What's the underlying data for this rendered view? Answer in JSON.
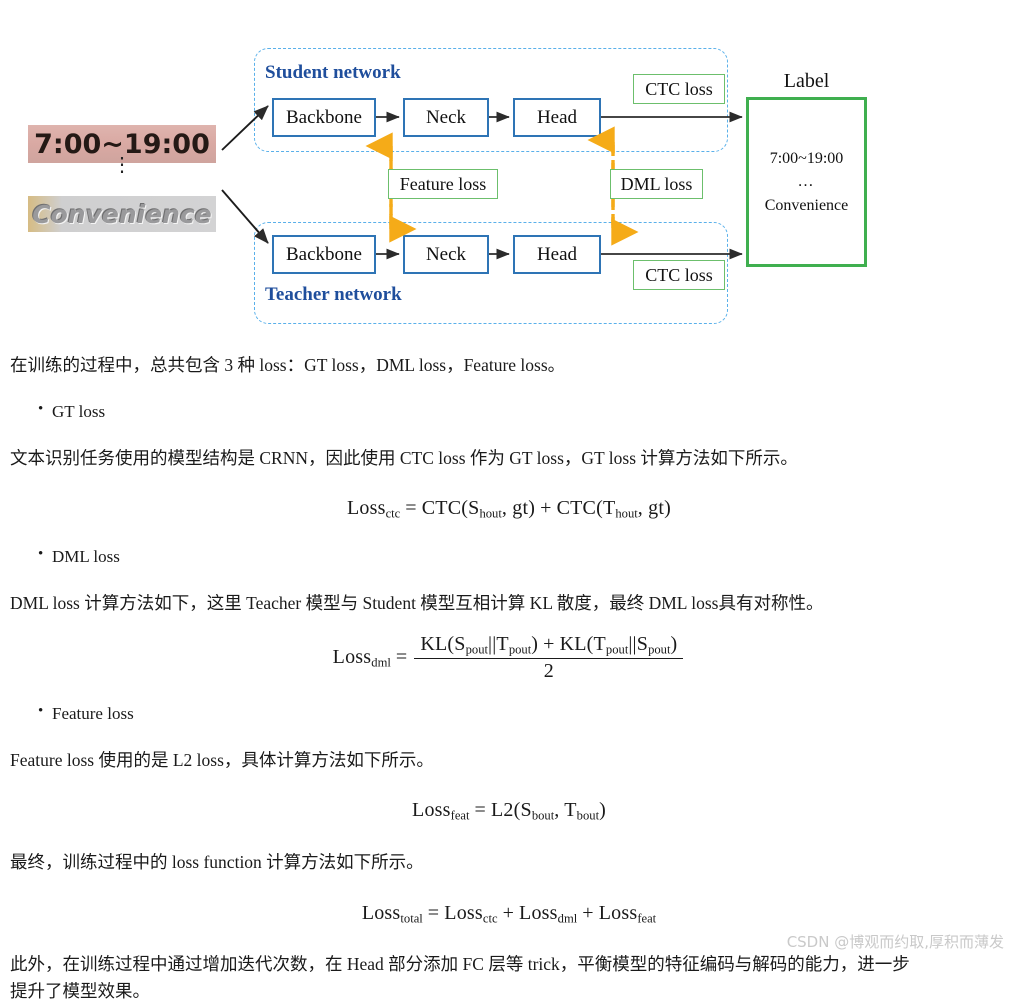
{
  "diagram": {
    "samples": {
      "time_image_text": "7:00~19:00",
      "ellipsis": "⋮",
      "convenience_image_text": "Convenience"
    },
    "student_network_label": "Student network",
    "teacher_network_label": "Teacher network",
    "student_modules": [
      "Backbone",
      "Neck",
      "Head"
    ],
    "teacher_modules": [
      "Backbone",
      "Neck",
      "Head"
    ],
    "loss_boxes": {
      "ctc_top": "CTC loss",
      "ctc_bottom": "CTC loss",
      "feature_loss": "Feature loss",
      "dml_loss": "DML loss"
    },
    "label": {
      "caption": "Label",
      "line1": "7:00~19:00",
      "line2": "…",
      "line3": "Convenience"
    },
    "colors": {
      "module_border": "#2e74b5",
      "network_dashed": "#59b0ea",
      "network_label_text": "#1f4e9c",
      "loss_box_border": "#6cbf6c",
      "label_box_border": "#3faf4f",
      "distill_arrow": "#f5ab18"
    }
  },
  "article": {
    "intro_paragraph": "在训练的过程中，总共包含 3 种 loss：GT loss，DML loss，Feature loss。",
    "bullet_gt": "GT loss",
    "gt_paragraph": "文本识别任务使用的模型结构是 CRNN，因此使用 CTC loss 作为 GT loss，GT loss 计算方法如下所示。",
    "formula_ctc": {
      "lhs_name": "Loss",
      "lhs_sub": "ctc",
      "equals": "=",
      "term1_fn": "CTC(",
      "term1_arg1": "S",
      "term1_arg1_sub": "hout",
      "term1_sep": ", ",
      "term1_arg2": "gt",
      "term1_close": ")",
      "plus": "+",
      "term2_fn": "CTC(",
      "term2_arg1": "T",
      "term2_arg1_sub": "hout",
      "term2_sep": ", ",
      "term2_arg2": "gt",
      "term2_close": ")"
    },
    "bullet_dml": "DML loss",
    "dml_paragraph": "DML loss 计算方法如下，这里 Teacher 模型与 Student 模型互相计算 KL 散度，最终 DML loss具有对称性。",
    "formula_dml": {
      "lhs_name": "Loss",
      "lhs_sub": "dml",
      "equals": "=",
      "num_kl1_open": "KL(",
      "num_kl1_a": "S",
      "num_kl1_a_sub": "pout",
      "num_kl1_bar": "||",
      "num_kl1_b": "T",
      "num_kl1_b_sub": "pout",
      "num_kl1_close": ")",
      "num_plus": "+",
      "num_kl2_open": "KL(",
      "num_kl2_a": "T",
      "num_kl2_a_sub": "pout",
      "num_kl2_bar": "||",
      "num_kl2_b": "S",
      "num_kl2_b_sub": "pout",
      "num_kl2_close": ")",
      "denominator": "2"
    },
    "bullet_feature": "Feature loss",
    "feature_paragraph": "Feature loss 使用的是 L2 loss，具体计算方法如下所示。",
    "formula_feat": {
      "lhs_name": "Loss",
      "lhs_sub": "feat",
      "equals": "=",
      "fn_open": "L2(",
      "arg1": "S",
      "arg1_sub": "bout",
      "sep": ", ",
      "arg2": "T",
      "arg2_sub": "bout",
      "close": ")"
    },
    "total_paragraph": "最终，训练过程中的 loss function 计算方法如下所示。",
    "formula_total": {
      "lhs_name": "Loss",
      "lhs_sub": "total",
      "equals": "=",
      "t1_name": "Loss",
      "t1_sub": "ctc",
      "plus1": "+",
      "t2_name": "Loss",
      "t2_sub": "dml",
      "plus2": "+",
      "t3_name": "Loss",
      "t3_sub": "feat"
    },
    "closing_paragraph": "此外，在训练过程中通过增加迭代次数，在 Head 部分添加 FC 层等 trick，平衡模型的特征编码与解码的能力，进一步提升了模型效果。"
  },
  "watermark": "CSDN @博观而约取,厚积而薄发"
}
